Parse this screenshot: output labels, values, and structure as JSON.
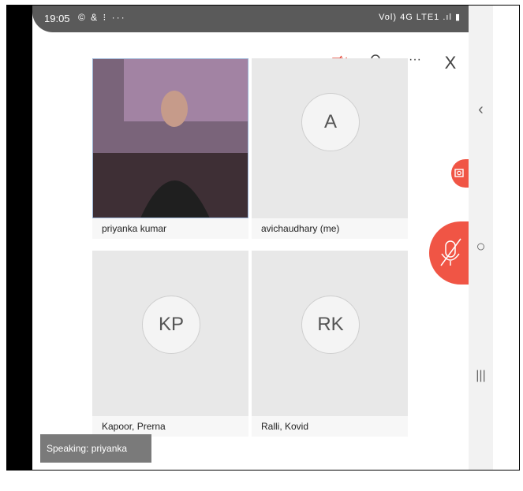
{
  "status_bar": {
    "time": "19:05",
    "notification_icons": "© & ⁝ ···",
    "system_text": "Vol) 4G LTE1 .ıl ▮"
  },
  "toolbar": {
    "camera_off_icon": "camera-off",
    "participants_icon": "participants",
    "more_label": "···",
    "close_label": "X"
  },
  "participants": [
    {
      "name": "priyanka kumar",
      "initials": "",
      "video": true
    },
    {
      "name": "avichaudhary (me)",
      "initials": "A",
      "video": false
    },
    {
      "name": "Kapoor, Prerna",
      "initials": "KP",
      "video": false
    },
    {
      "name": "Ralli, Kovid",
      "initials": "RK",
      "video": false
    }
  ],
  "speaking_label": "Speaking: priyanka kumar",
  "nav": {
    "back": "‹",
    "home": "○",
    "recents": "|||"
  },
  "colors": {
    "accent": "#f05545",
    "statusbar": "#5a5a5a",
    "tile": "#e8e8e8"
  }
}
